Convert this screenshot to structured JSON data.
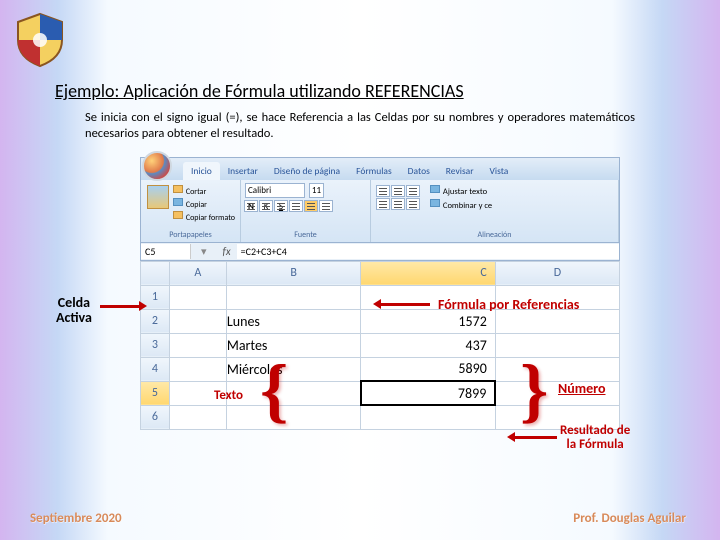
{
  "title": "Ejemplo: Aplicación de Fórmula utilizando REFERENCIAS",
  "subtitle": "Se inicia con el signo igual (=), se hace Referencia a las Celdas por su nombres y operadores matemáticos necesarios para obtener el resultado.",
  "ribbon": {
    "tabs": [
      "Inicio",
      "Insertar",
      "Diseño de página",
      "Fórmulas",
      "Datos",
      "Revisar",
      "Vista"
    ],
    "clip": [
      "Cortar",
      "Copiar",
      "Copiar formato"
    ],
    "g1": "Portapapeles",
    "font": "Calibri",
    "size": "11",
    "g2": "Fuente",
    "wrap": "Ajustar texto",
    "merge": "Combinar y ce",
    "g3": "Alineación"
  },
  "cellref": "C5",
  "formula": "=C2+C3+C4",
  "cols": {
    "A": "A",
    "B": "B",
    "C": "C",
    "D": "D"
  },
  "rows": {
    "r1": {
      "n": "1",
      "b": "",
      "c": ""
    },
    "r2": {
      "n": "2",
      "b": "Lunes",
      "c": "1572"
    },
    "r3": {
      "n": "3",
      "b": "Martes",
      "c": "437"
    },
    "r4": {
      "n": "4",
      "b": "Miércoles",
      "c": "5890"
    },
    "r5": {
      "n": "5",
      "b": "",
      "c": "7899"
    },
    "r6": {
      "n": "6",
      "b": "",
      "c": ""
    }
  },
  "labels": {
    "celda1": "Celda",
    "celda2": "Activa",
    "formula": "Fórmula por  Referencias",
    "texto": "Texto",
    "numero": "Número",
    "res1": "Resultado de",
    "res2": "la Fórmula"
  },
  "footer": {
    "left": "Septiembre 2020",
    "right": "Prof. Douglas Aguilar"
  }
}
